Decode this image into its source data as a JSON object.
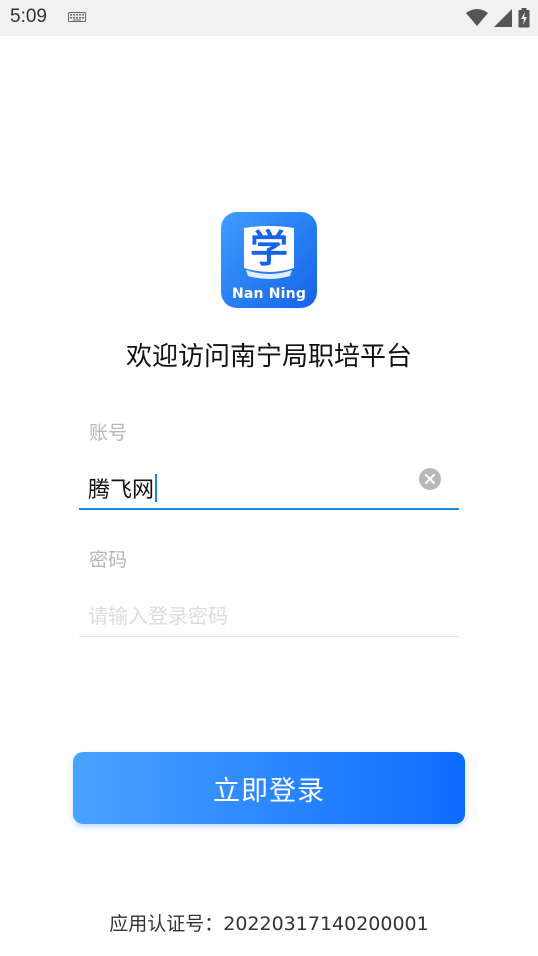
{
  "status_bar": {
    "time": "5:09",
    "icons": [
      "keyboard-icon",
      "wifi-icon",
      "cell-signal-icon",
      "battery-charging-icon"
    ]
  },
  "logo": {
    "glyph": "学",
    "text": "Nan Ning",
    "colors": {
      "start": "#3f9dff",
      "end": "#1563e8"
    }
  },
  "title": "欢迎访问南宁局职培平台",
  "account": {
    "label": "账号",
    "value": "腾飞网"
  },
  "password": {
    "label": "密码",
    "placeholder": "请输入登录密码"
  },
  "login_button": {
    "label": "立即登录",
    "color_start": "#4aa3ff",
    "color_end": "#0d6cff"
  },
  "certification": "应用认证号：20220317140200001",
  "accent_color": "#1e88e5"
}
